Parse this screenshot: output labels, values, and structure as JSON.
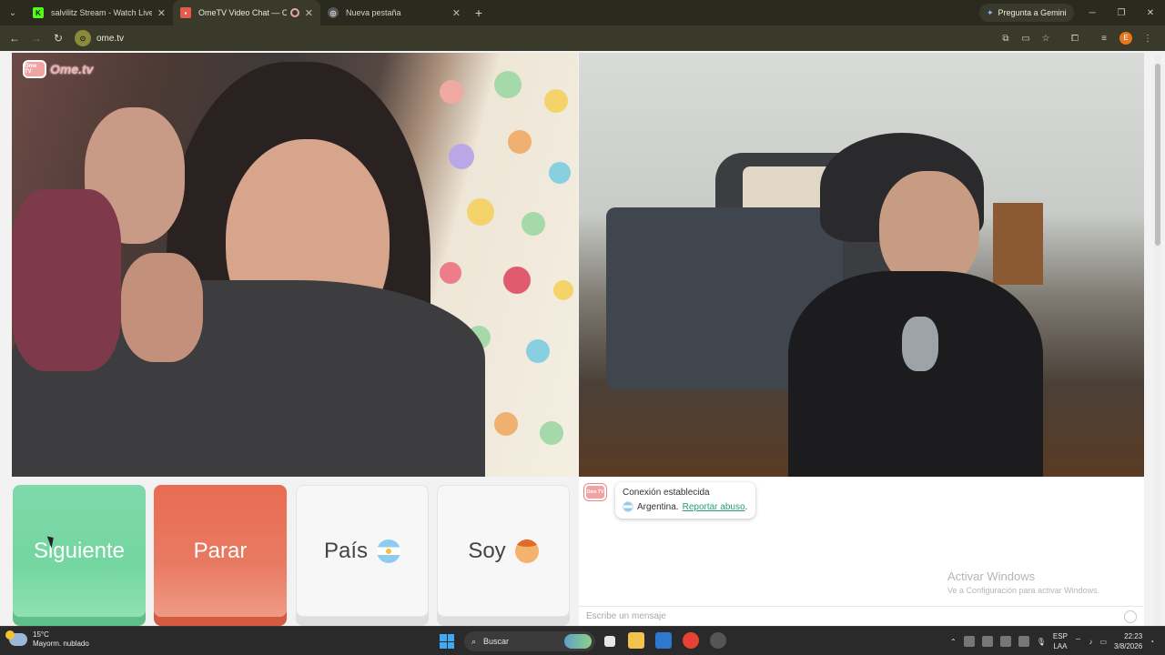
{
  "browser": {
    "tabs": [
      {
        "title": "salvilitz Stream - Watch Live on",
        "favicon": "kick-icon",
        "active": false
      },
      {
        "title": "OmeTV Video Chat — Ome",
        "favicon": "ometv-icon",
        "active": true
      },
      {
        "title": "Nueva pestaña",
        "favicon": "chrome-icon",
        "active": false
      }
    ],
    "gemini_label": "Pregunta a Gemini",
    "url": "ome.tv",
    "profile_initial": "E"
  },
  "page": {
    "logo_text": "Ome.tv",
    "logo_badge": "Ome TV",
    "buttons": {
      "next": "Siguiente",
      "stop": "Parar",
      "country": "País",
      "gender": "Soy"
    },
    "chat": {
      "status": "Conexión establecida",
      "country": "Argentina.",
      "report": "Reportar abuso",
      "report_suffix": ".",
      "placeholder": "Escribe un mensaje"
    },
    "watermark": {
      "line1": "Activar Windows",
      "line2": "Ve a Configuración para activar Windows."
    }
  },
  "taskbar": {
    "temperature": "15°C",
    "condition": "Mayorm. nublado",
    "search": "Buscar",
    "lang_top": "ESP",
    "lang_bottom": "LAA",
    "time": "22:23",
    "date": "3/8/2026"
  },
  "colors": {
    "next": "#74d6a0",
    "stop": "#e97a62",
    "report_link": "#2a9d7a"
  }
}
